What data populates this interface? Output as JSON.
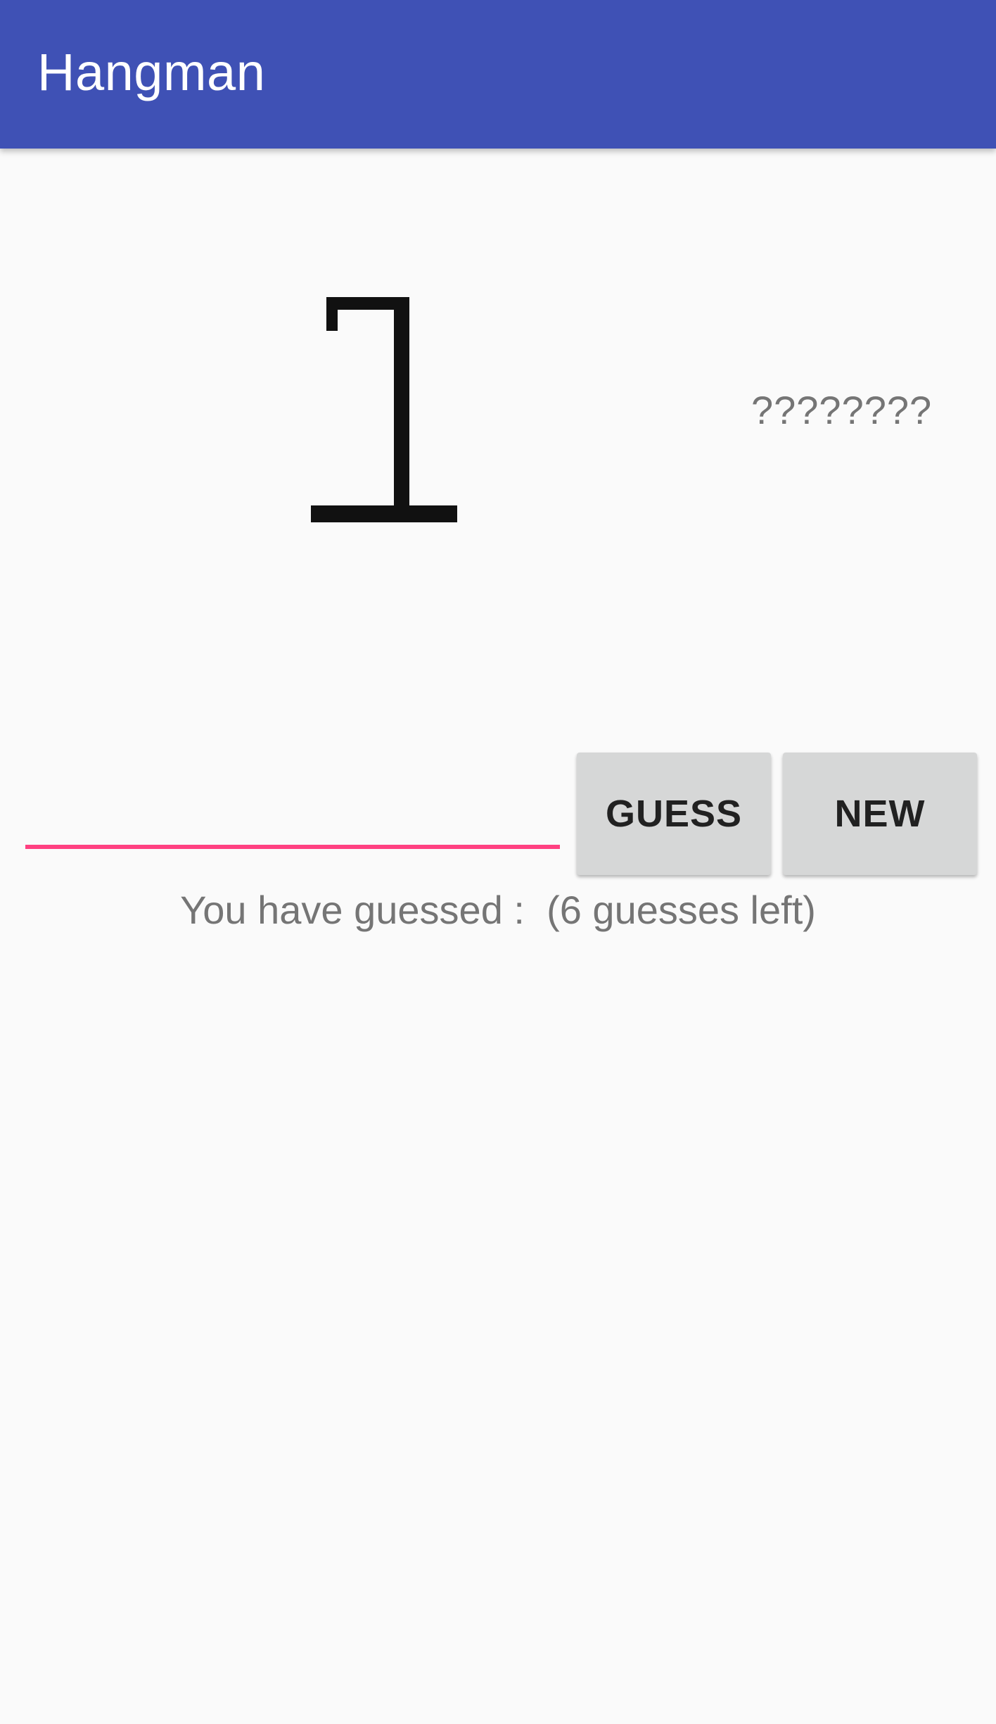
{
  "app_bar": {
    "title": "Hangman",
    "color": "#3f51b5"
  },
  "game": {
    "hangman_image": "hangman-stage-1",
    "hidden_word": "????????",
    "guess_input": {
      "value": "",
      "placeholder": "",
      "underline_color": "#ff4081"
    },
    "guess_button_label": "GUESS",
    "new_button_label": "NEW",
    "status_text": "You have guessed :  (6 guesses left)"
  }
}
